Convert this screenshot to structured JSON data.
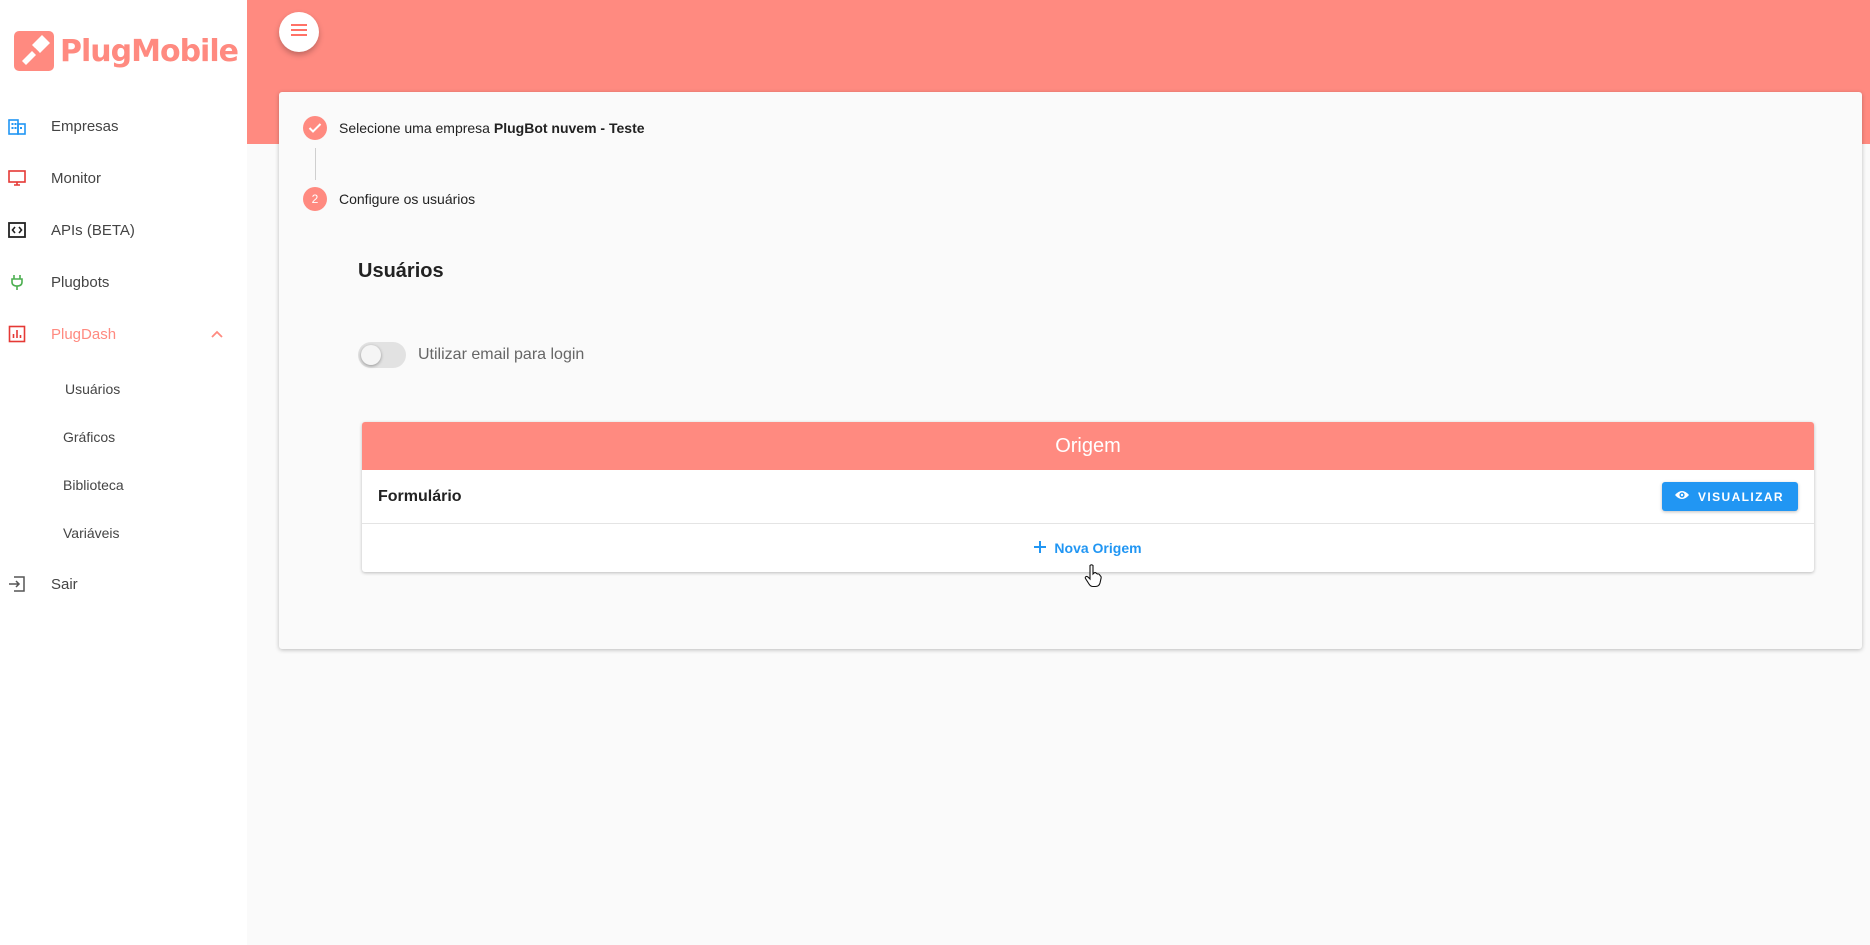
{
  "brand": {
    "name": "PlugMobile",
    "color": "#ff8a80"
  },
  "sidebar": {
    "items": [
      {
        "label": "Empresas",
        "icon": "building-icon",
        "icon_color": "#2196f3"
      },
      {
        "label": "Monitor",
        "icon": "monitor-icon",
        "icon_color": "#e53935"
      },
      {
        "label": "APIs (BETA)",
        "icon": "code-icon",
        "icon_color": "#222222"
      },
      {
        "label": "Plugbots",
        "icon": "plug-icon",
        "icon_color": "#4caf50"
      },
      {
        "label": "PlugDash",
        "icon": "chart-icon",
        "icon_color": "#e53935",
        "expanded": true,
        "active": true
      }
    ],
    "subitems": [
      {
        "label": "Usuários"
      },
      {
        "label": "Gráficos"
      },
      {
        "label": "Biblioteca"
      },
      {
        "label": "Variáveis"
      }
    ],
    "logout": {
      "label": "Sair",
      "icon": "logout-icon"
    }
  },
  "header": {
    "menu_icon": "menu-icon"
  },
  "stepper": {
    "step1": {
      "text": "Selecione uma empresa",
      "value": "PlugBot nuvem - Teste",
      "state": "done"
    },
    "step2": {
      "number": "2",
      "text": "Configure os usuários",
      "state": "active"
    }
  },
  "main": {
    "title": "Usuários",
    "toggle": {
      "label": "Utilizar email para login",
      "checked": false
    },
    "origem": {
      "header": "Origem",
      "rows": [
        {
          "name": "Formulário",
          "action_label": "VISUALIZAR"
        }
      ],
      "add_label": "Nova Origem"
    }
  },
  "colors": {
    "accent": "#ff8a80",
    "primary": "#2196f3"
  }
}
